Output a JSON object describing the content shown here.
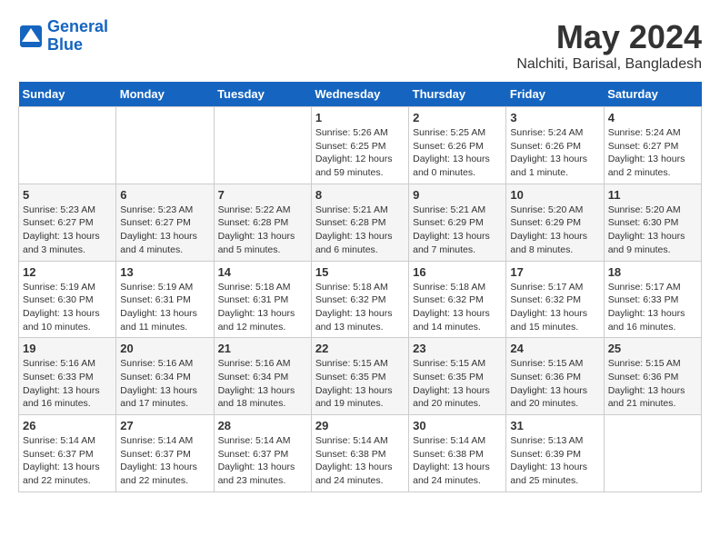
{
  "logo": {
    "line1": "General",
    "line2": "Blue"
  },
  "title": "May 2024",
  "subtitle": "Nalchiti, Barisal, Bangladesh",
  "days_header": [
    "Sunday",
    "Monday",
    "Tuesday",
    "Wednesday",
    "Thursday",
    "Friday",
    "Saturday"
  ],
  "weeks": [
    [
      {
        "day": "",
        "info": ""
      },
      {
        "day": "",
        "info": ""
      },
      {
        "day": "",
        "info": ""
      },
      {
        "day": "1",
        "info": "Sunrise: 5:26 AM\nSunset: 6:25 PM\nDaylight: 12 hours and 59 minutes."
      },
      {
        "day": "2",
        "info": "Sunrise: 5:25 AM\nSunset: 6:26 PM\nDaylight: 13 hours and 0 minutes."
      },
      {
        "day": "3",
        "info": "Sunrise: 5:24 AM\nSunset: 6:26 PM\nDaylight: 13 hours and 1 minute."
      },
      {
        "day": "4",
        "info": "Sunrise: 5:24 AM\nSunset: 6:27 PM\nDaylight: 13 hours and 2 minutes."
      }
    ],
    [
      {
        "day": "5",
        "info": "Sunrise: 5:23 AM\nSunset: 6:27 PM\nDaylight: 13 hours and 3 minutes."
      },
      {
        "day": "6",
        "info": "Sunrise: 5:23 AM\nSunset: 6:27 PM\nDaylight: 13 hours and 4 minutes."
      },
      {
        "day": "7",
        "info": "Sunrise: 5:22 AM\nSunset: 6:28 PM\nDaylight: 13 hours and 5 minutes."
      },
      {
        "day": "8",
        "info": "Sunrise: 5:21 AM\nSunset: 6:28 PM\nDaylight: 13 hours and 6 minutes."
      },
      {
        "day": "9",
        "info": "Sunrise: 5:21 AM\nSunset: 6:29 PM\nDaylight: 13 hours and 7 minutes."
      },
      {
        "day": "10",
        "info": "Sunrise: 5:20 AM\nSunset: 6:29 PM\nDaylight: 13 hours and 8 minutes."
      },
      {
        "day": "11",
        "info": "Sunrise: 5:20 AM\nSunset: 6:30 PM\nDaylight: 13 hours and 9 minutes."
      }
    ],
    [
      {
        "day": "12",
        "info": "Sunrise: 5:19 AM\nSunset: 6:30 PM\nDaylight: 13 hours and 10 minutes."
      },
      {
        "day": "13",
        "info": "Sunrise: 5:19 AM\nSunset: 6:31 PM\nDaylight: 13 hours and 11 minutes."
      },
      {
        "day": "14",
        "info": "Sunrise: 5:18 AM\nSunset: 6:31 PM\nDaylight: 13 hours and 12 minutes."
      },
      {
        "day": "15",
        "info": "Sunrise: 5:18 AM\nSunset: 6:32 PM\nDaylight: 13 hours and 13 minutes."
      },
      {
        "day": "16",
        "info": "Sunrise: 5:18 AM\nSunset: 6:32 PM\nDaylight: 13 hours and 14 minutes."
      },
      {
        "day": "17",
        "info": "Sunrise: 5:17 AM\nSunset: 6:32 PM\nDaylight: 13 hours and 15 minutes."
      },
      {
        "day": "18",
        "info": "Sunrise: 5:17 AM\nSunset: 6:33 PM\nDaylight: 13 hours and 16 minutes."
      }
    ],
    [
      {
        "day": "19",
        "info": "Sunrise: 5:16 AM\nSunset: 6:33 PM\nDaylight: 13 hours and 16 minutes."
      },
      {
        "day": "20",
        "info": "Sunrise: 5:16 AM\nSunset: 6:34 PM\nDaylight: 13 hours and 17 minutes."
      },
      {
        "day": "21",
        "info": "Sunrise: 5:16 AM\nSunset: 6:34 PM\nDaylight: 13 hours and 18 minutes."
      },
      {
        "day": "22",
        "info": "Sunrise: 5:15 AM\nSunset: 6:35 PM\nDaylight: 13 hours and 19 minutes."
      },
      {
        "day": "23",
        "info": "Sunrise: 5:15 AM\nSunset: 6:35 PM\nDaylight: 13 hours and 20 minutes."
      },
      {
        "day": "24",
        "info": "Sunrise: 5:15 AM\nSunset: 6:36 PM\nDaylight: 13 hours and 20 minutes."
      },
      {
        "day": "25",
        "info": "Sunrise: 5:15 AM\nSunset: 6:36 PM\nDaylight: 13 hours and 21 minutes."
      }
    ],
    [
      {
        "day": "26",
        "info": "Sunrise: 5:14 AM\nSunset: 6:37 PM\nDaylight: 13 hours and 22 minutes."
      },
      {
        "day": "27",
        "info": "Sunrise: 5:14 AM\nSunset: 6:37 PM\nDaylight: 13 hours and 22 minutes."
      },
      {
        "day": "28",
        "info": "Sunrise: 5:14 AM\nSunset: 6:37 PM\nDaylight: 13 hours and 23 minutes."
      },
      {
        "day": "29",
        "info": "Sunrise: 5:14 AM\nSunset: 6:38 PM\nDaylight: 13 hours and 24 minutes."
      },
      {
        "day": "30",
        "info": "Sunrise: 5:14 AM\nSunset: 6:38 PM\nDaylight: 13 hours and 24 minutes."
      },
      {
        "day": "31",
        "info": "Sunrise: 5:13 AM\nSunset: 6:39 PM\nDaylight: 13 hours and 25 minutes."
      },
      {
        "day": "",
        "info": ""
      }
    ]
  ]
}
